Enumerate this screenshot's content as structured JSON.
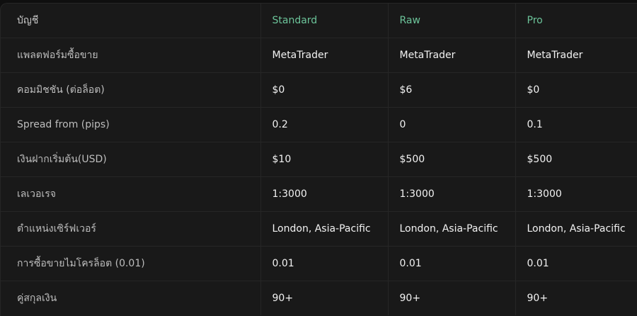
{
  "table": {
    "header": {
      "label": "บัญชี",
      "columns": [
        "Standard",
        "Raw",
        "Pro"
      ]
    },
    "rows": [
      {
        "label": "แพลตฟอร์มซื้อขาย",
        "values": [
          "MetaTrader",
          "MetaTrader",
          "MetaTrader"
        ]
      },
      {
        "label": "คอมมิชชัน (ต่อล็อต)",
        "values": [
          "$0",
          "$6",
          "$0"
        ]
      },
      {
        "label": "Spread from (pips)",
        "values": [
          "0.2",
          "0",
          "0.1"
        ]
      },
      {
        "label": "เงินฝากเริ่มต้น(USD)",
        "values": [
          "$10",
          "$500",
          "$500"
        ]
      },
      {
        "label": "เลเวอเรจ",
        "values": [
          "1:3000",
          "1:3000",
          "1:3000"
        ]
      },
      {
        "label": "ตำแหน่งเซิร์ฟเวอร์",
        "values": [
          "London, Asia-Pacific",
          "London, Asia-Pacific",
          "London, Asia-Pacific"
        ]
      },
      {
        "label": "การซื้อขายไมโครล็อต (0.01)",
        "values": [
          "0.01",
          "0.01",
          "0.01"
        ]
      },
      {
        "label": "คู่สกุลเงิน",
        "values": [
          "90+",
          "90+",
          "90+"
        ]
      }
    ]
  },
  "colors": {
    "background": "#191919",
    "accent": "#6cc49a",
    "text": "#f2f2f2",
    "muted": "#bdbdbd",
    "border": "#262626"
  }
}
